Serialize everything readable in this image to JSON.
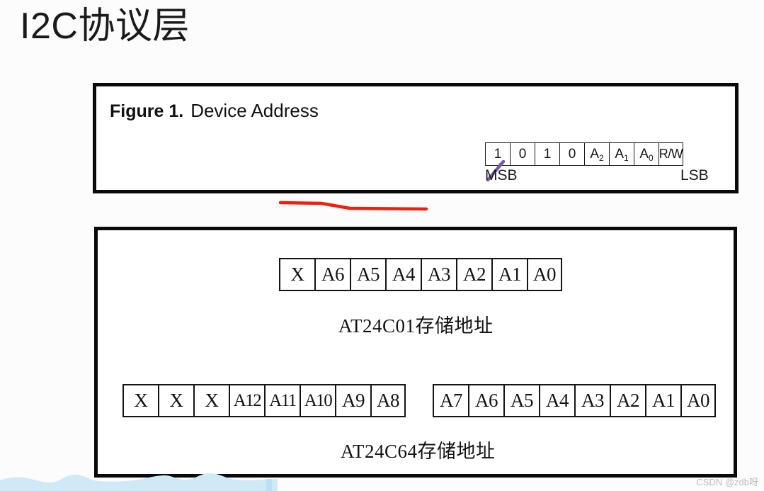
{
  "slide": {
    "title": "I2C协议层",
    "background_color": "#fcfcfc"
  },
  "figure1": {
    "label": "Figure 1.",
    "title": "Device Address",
    "underline_color": "#f01f0e",
    "bit_cells": [
      {
        "text": "1",
        "sub": ""
      },
      {
        "text": "0",
        "sub": ""
      },
      {
        "text": "1",
        "sub": ""
      },
      {
        "text": "0",
        "sub": ""
      },
      {
        "text": "A",
        "sub": "2"
      },
      {
        "text": "A",
        "sub": "1"
      },
      {
        "text": "A",
        "sub": "0"
      },
      {
        "text": "R/W",
        "sub": ""
      }
    ],
    "msb_label": "MSB",
    "lsb_label": "LSB",
    "pointer_color": "#7a5ba8"
  },
  "figure2": {
    "at24c01": {
      "cells": [
        "X",
        "A6",
        "A5",
        "A4",
        "A3",
        "A2",
        "A1",
        "A0"
      ],
      "caption": "AT24C01存储地址"
    },
    "at24c64": {
      "high_byte_cells": [
        "X",
        "X",
        "X",
        "A12",
        "A11",
        "A10",
        "A9",
        "A8"
      ],
      "low_byte_cells": [
        "A7",
        "A6",
        "A5",
        "A4",
        "A3",
        "A2",
        "A1",
        "A0"
      ],
      "caption": "AT24C64存储地址"
    }
  },
  "decor": {
    "wave_color": "#cfe9f7"
  },
  "watermark": {
    "text": "CSDN @zdb呀"
  }
}
